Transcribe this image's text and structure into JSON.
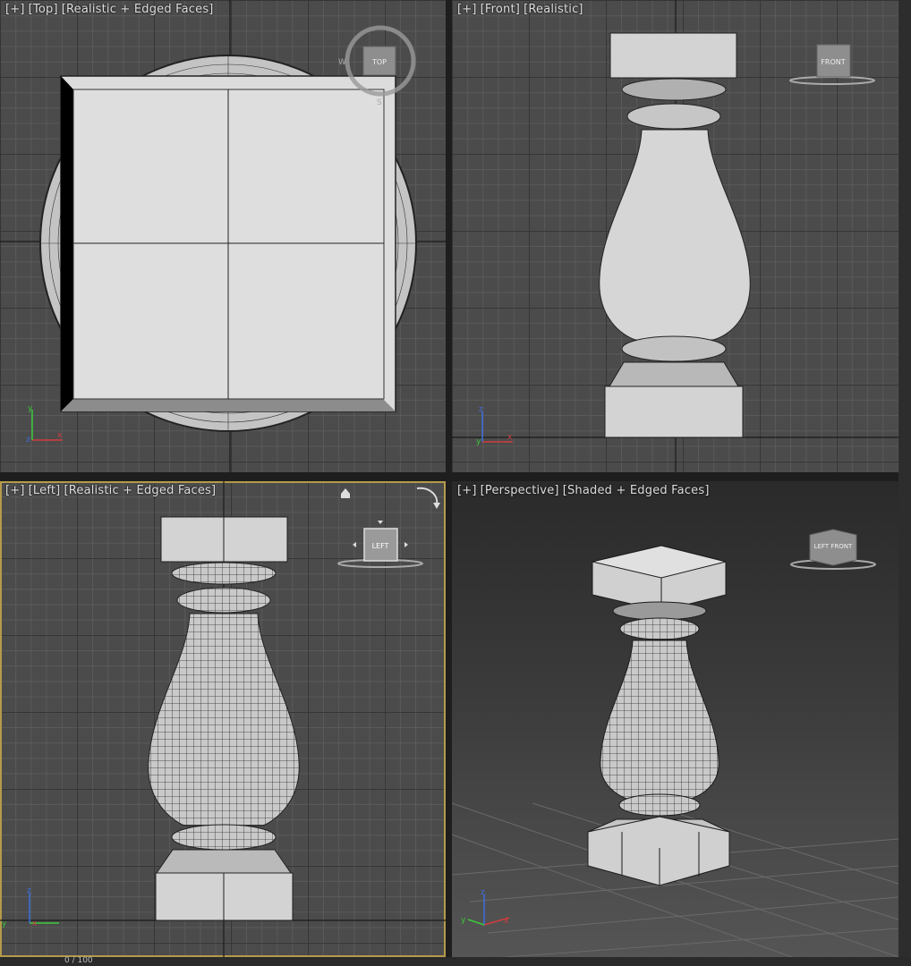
{
  "viewports": {
    "top": {
      "plus": "[+]",
      "view": "[Top]",
      "mode": "[Realistic + Edged Faces]",
      "cube_label": "TOP"
    },
    "front": {
      "plus": "[+]",
      "view": "[Front]",
      "mode": "[Realistic]",
      "cube_label": "FRONT"
    },
    "left": {
      "plus": "[+]",
      "view": "[Left]",
      "mode": "[Realistic + Edged Faces]",
      "cube_label": "LEFT"
    },
    "perspective": {
      "plus": "[+]",
      "view": "[Perspective]",
      "mode": "[Shaded + Edged Faces]",
      "cube_label": "LEFT FRONT"
    }
  },
  "axes": {
    "x": "x",
    "y": "y",
    "z": "z"
  },
  "compass": {
    "w": "W",
    "s": "S"
  },
  "status": {
    "frame_counter": "0 / 100"
  },
  "colors": {
    "x_axis": "#d23c3c",
    "y_axis": "#3cc83c",
    "z_axis": "#3c6edc",
    "active_border": "#b59a4a"
  }
}
